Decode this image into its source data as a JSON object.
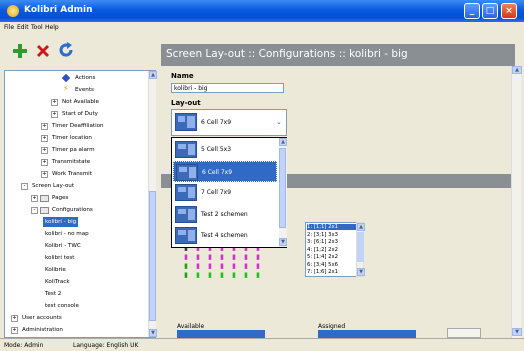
{
  "window": {
    "title": "Kolibri Admin"
  },
  "menu": [
    "File",
    "Edit",
    "Tool",
    "Help"
  ],
  "tree": {
    "items": [
      {
        "label": "Actions",
        "indent": 5,
        "icon": "diamond"
      },
      {
        "label": "Events",
        "indent": 5,
        "icon": "bolt"
      },
      {
        "label": "Not Available",
        "indent": 4,
        "exp": "+"
      },
      {
        "label": "Start of Duty",
        "indent": 4,
        "exp": "+"
      },
      {
        "label": "Timer Deaffiliation",
        "indent": 3,
        "exp": "+"
      },
      {
        "label": "Timer location",
        "indent": 3,
        "exp": "+"
      },
      {
        "label": "Timer pa alarm",
        "indent": 3,
        "exp": "+"
      },
      {
        "label": "Transmitstate",
        "indent": 3,
        "exp": "+"
      },
      {
        "label": "Work Transmit",
        "indent": 3,
        "exp": "+"
      },
      {
        "label": "Screen Lay-out",
        "indent": 1,
        "exp": "-"
      },
      {
        "label": "Pages",
        "indent": 2,
        "exp": "+"
      },
      {
        "label": "Configurations",
        "indent": 2,
        "exp": "-"
      },
      {
        "label": "kolibri - big",
        "indent": 3,
        "selected": true
      },
      {
        "label": "kolibri - no map",
        "indent": 3
      },
      {
        "label": "Kolibri - TWC",
        "indent": 3
      },
      {
        "label": "kolibri test",
        "indent": 3
      },
      {
        "label": "Kolibrie",
        "indent": 3
      },
      {
        "label": "KoliTrack",
        "indent": 3
      },
      {
        "label": "Test 2",
        "indent": 3
      },
      {
        "label": "test console",
        "indent": 3
      },
      {
        "label": "User accounts",
        "indent": 0,
        "exp": "+"
      },
      {
        "label": "Administration",
        "indent": 0,
        "exp": "+"
      }
    ]
  },
  "panel": {
    "header": "Screen Lay-out :: Configurations :: kolibri - big",
    "name_label": "Name",
    "name_value": "kolibri - big",
    "layout_label": "Lay-out",
    "layout_value": "6 Cell 7x9"
  },
  "dropdown": {
    "options": [
      {
        "label": "5 Cell 5x3"
      },
      {
        "label": "6 Cell 7x9",
        "selected": true
      },
      {
        "label": "7 Cell 7x9"
      },
      {
        "label": "Test 2 schemen"
      },
      {
        "label": "Test 4 schemen"
      }
    ]
  },
  "assigned_list": [
    "1: [1;1] 2x1",
    "2: [3;1] 3x3",
    "3: [6;1] 2x3",
    "4: [1;2] 2x2",
    "5: [1;4] 2x2",
    "6: [3;4] 5x6",
    "7: [1;6] 2x1"
  ],
  "bottom": {
    "available_label": "Available",
    "assigned_label": "Assigned"
  },
  "status": {
    "mode": "Mode: Admin",
    "language": "Language: English UK"
  },
  "colors": {
    "header_bg": "#8a8f94",
    "selection": "#316ac5",
    "titlebar": "#0a5ae0"
  }
}
